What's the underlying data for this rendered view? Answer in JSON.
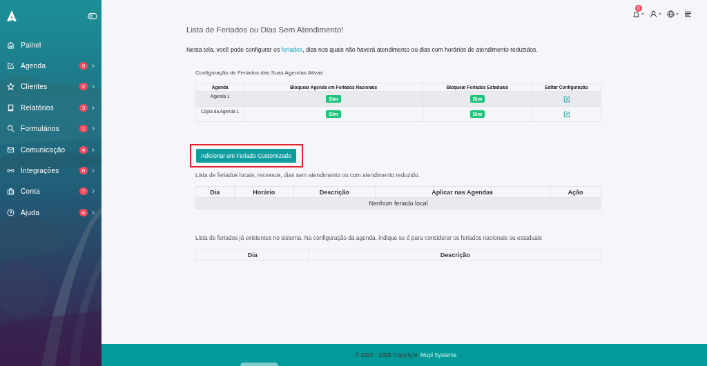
{
  "sidebar": {
    "items": [
      {
        "label": "Painel"
      },
      {
        "label": "Agenda",
        "badge": "9"
      },
      {
        "label": "Clientes",
        "badge": "2"
      },
      {
        "label": "Relatórios",
        "badge": "3"
      },
      {
        "label": "Formulários",
        "badge": "1"
      },
      {
        "label": "Comunicação",
        "badge": "4"
      },
      {
        "label": "Integrações",
        "badge": "6"
      },
      {
        "label": "Conta",
        "badge": "7"
      },
      {
        "label": "Ajuda",
        "badge": "4"
      }
    ]
  },
  "topbar": {
    "notification_count": "0"
  },
  "page": {
    "title": "Lista de Feriados ou Dias Sem Atendimento!",
    "intro_before": "Nesta tela, você pode configurar os",
    "intro_link": "feriados",
    "intro_after": ", dias nos quais não haverá atendimento ou dias com horários de atendimento reduzidos."
  },
  "config_table": {
    "title": "Configuração de Feriados das Suas Agendas Ativas",
    "columns": [
      "Agenda",
      "Bloquear Agenda em Feriados Nacionais",
      "Bloquear Feriados Estaduais",
      "Editar Configuração"
    ],
    "rows": [
      {
        "agenda": "Agenda 1",
        "national": "Sim",
        "state": "Sim",
        "selected": true
      },
      {
        "agenda": "Cópia da Agenda 1",
        "national": "Sim",
        "state": "Sim",
        "selected": false
      }
    ]
  },
  "add_button": {
    "label": "Adicionar um Feriado Customizado",
    "highlighted": true
  },
  "local_table": {
    "description": "Lista de feriados locais, recessos, dias sem atendimento ou com atendimento reduzido.",
    "columns": [
      "Dia",
      "Horário",
      "Descrição",
      "Aplicar nas Agendas",
      "Ação"
    ],
    "empty_text": "Nenhum feriado local"
  },
  "system_table": {
    "description": "Lista de feriados já existentes no sistema. Na configuração da agenda, indique se é para considerar os feriados nacionais ou estaduais",
    "columns": [
      "Dia",
      "Descrição"
    ]
  },
  "footer": {
    "text": "© 2020 - 2025 Copyright:",
    "link": "Mupi Systems"
  }
}
